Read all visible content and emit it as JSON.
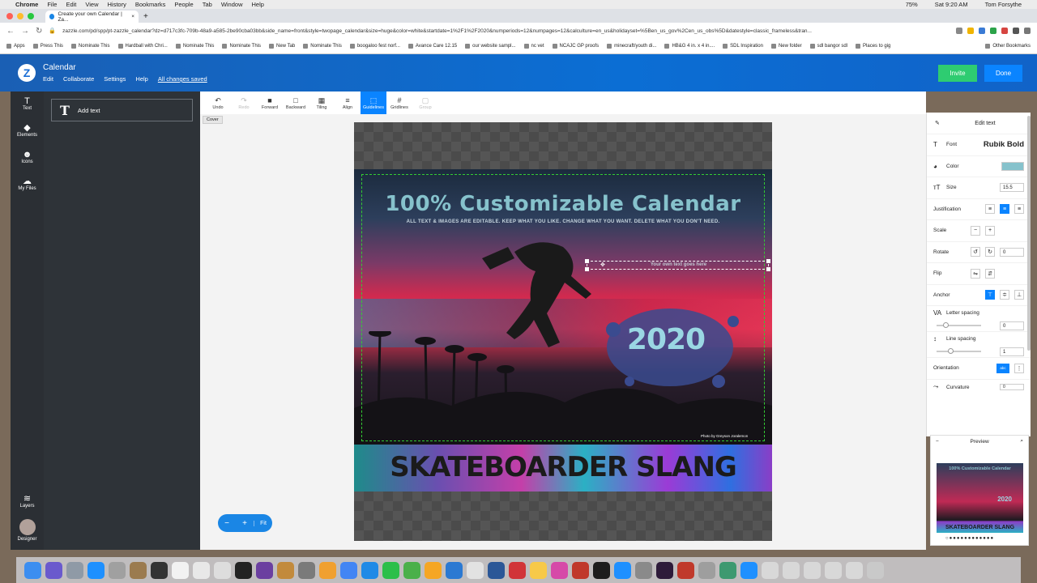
{
  "menubar": {
    "app": "Chrome",
    "items": [
      "File",
      "Edit",
      "View",
      "History",
      "Bookmarks",
      "People",
      "Tab",
      "Window",
      "Help"
    ],
    "status_right": [
      "75%",
      "Sat 9:20 AM",
      "Tom Forsythe"
    ]
  },
  "browser": {
    "tab_title": "Create your own Calendar | Za...",
    "url": "zazzle.com/pd/spp/pt-zazzle_calendar?dz=d717c3fc-709b-48a9-a585-2be90cba03bb&side_name=front&style=twopage_calendar&size=huge&color=white&startdate=1%2F1%2F2020&numperiods=12&numpages=12&calculture=en_us&holidayset=%5Ben_us_gov%2Cen_us_obs%5D&datestyle=classic_frameless&tran...",
    "bookmarks": [
      "Apps",
      "Press This",
      "Nominate This",
      "Hardball with Chri...",
      "Nominate This",
      "Nominate This",
      "New Tab",
      "Nominate This",
      "boogaloo fest norf...",
      "Avance Care 12.15",
      "our website sampl...",
      "nc vet",
      "NCAJC GP proofs",
      "minecraft/youth di...",
      "HB&G 4 in. x 4 in....",
      "SDL Inspiration",
      "New folder",
      "sdl bangor sdl",
      "Places to gig"
    ],
    "other_bookmarks": "Other Bookmarks"
  },
  "app": {
    "title": "Calendar",
    "menu": [
      "Edit",
      "Collaborate",
      "Settings",
      "Help"
    ],
    "saved_status": "All changes saved",
    "invite": "Invite",
    "done": "Done"
  },
  "rail": {
    "items": [
      {
        "label": "Text",
        "icon": "text-icon"
      },
      {
        "label": "Elements",
        "icon": "elements-icon"
      },
      {
        "label": "Icons",
        "icon": "smiley-icon"
      },
      {
        "label": "My Files",
        "icon": "cloud-upload-icon"
      }
    ],
    "layers": "Layers",
    "designer": "Designer"
  },
  "panel": {
    "add_text": "Add text"
  },
  "toolbar": {
    "tools": [
      {
        "label": "Undo",
        "icon": "↶",
        "state": "normal"
      },
      {
        "label": "Redo",
        "icon": "↷",
        "state": "disabled"
      },
      {
        "label": "Forward",
        "icon": "■",
        "state": "normal"
      },
      {
        "label": "Backward",
        "icon": "□",
        "state": "normal"
      },
      {
        "label": "Tiling",
        "icon": "▦",
        "state": "normal"
      },
      {
        "label": "Align",
        "icon": "≡",
        "state": "normal"
      },
      {
        "label": "Guidelines",
        "icon": "⬚",
        "state": "active"
      },
      {
        "label": "Gridlines",
        "icon": "#",
        "state": "normal"
      },
      {
        "label": "Group",
        "icon": "▢",
        "state": "disabled"
      }
    ],
    "cover_badge": "Cover"
  },
  "design": {
    "title": "100% Customizable Calendar",
    "subtitle": "ALL TEXT & IMAGES ARE EDITABLE. KEEP WHAT YOU LIKE. CHANGE WHAT YOU WANT. DELETE WHAT YOU DON'T NEED.",
    "selected_text": "Your own text goes here",
    "year": "2020",
    "photo_credit": "Photo by Greyson Joralemon",
    "banner": "SKATEBOARDER SLANG",
    "title_color": "#86c2cc"
  },
  "zoom": {
    "minus": "−",
    "plus": "+",
    "fit": "Fit"
  },
  "edit_panel": {
    "header": "Edit text",
    "font_label": "Font",
    "font_value": "Rubik Bold",
    "color_label": "Color",
    "color_value": "#86c2cc",
    "size_label": "Size",
    "size_value": "15.5",
    "justification_label": "Justification",
    "scale_label": "Scale",
    "rotate_label": "Rotate",
    "rotate_value": "0",
    "flip_label": "Flip",
    "anchor_label": "Anchor",
    "letter_spacing_label": "Letter spacing",
    "letter_spacing_value": "0",
    "line_spacing_label": "Line spacing",
    "line_spacing_value": "1",
    "orientation_label": "Orientation",
    "orientation_value": "abc",
    "curvature_label": "Curvature",
    "curvature_value": "0"
  },
  "preview": {
    "label": "Preview",
    "thumb_title": "100% Customizable Calendar",
    "thumb_year": "2020",
    "thumb_banner": "SKATEBOARDER SLANG",
    "dots": "○●●●●●●●●●●●●"
  }
}
